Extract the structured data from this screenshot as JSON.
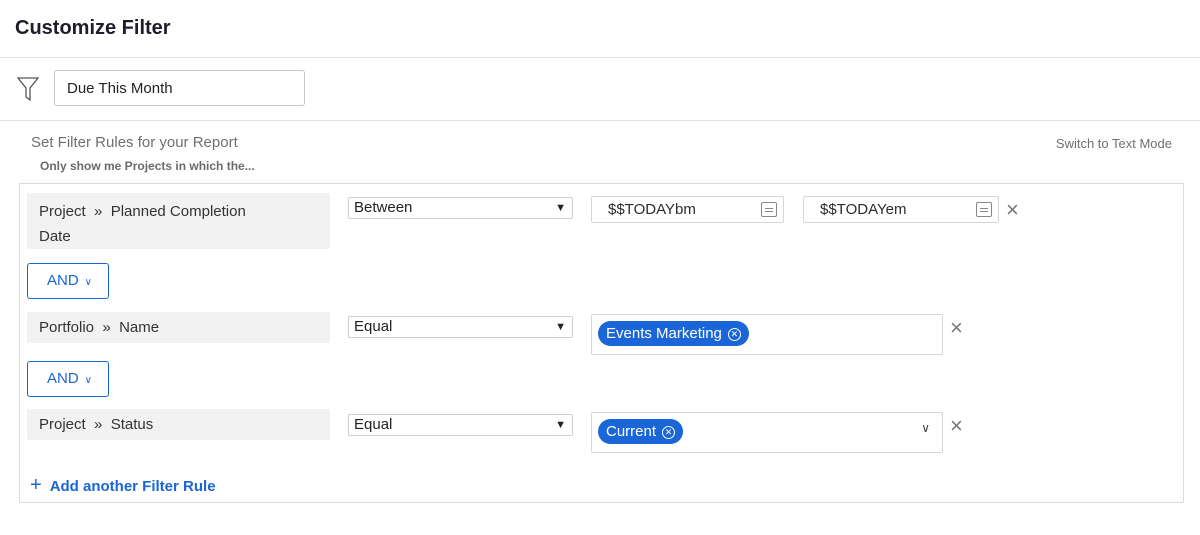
{
  "title": "Customize Filter",
  "filter_name": "Due This Month",
  "rules_heading": "Set Filter Rules for your Report",
  "rules_subheading": "Only show me Projects in which the...",
  "switch_mode": "Switch to Text Mode",
  "rules": [
    {
      "object": "Project",
      "separator": "»",
      "field_line1": "Planned Completion",
      "field_line2": "Date",
      "operator": "Between",
      "value1": "$$TODAYbm",
      "value2": "$$TODAYem"
    },
    {
      "object": "Portfolio",
      "separator": "»",
      "field": "Name",
      "operator": "Equal",
      "tag": "Events Marketing"
    },
    {
      "object": "Project",
      "separator": "»",
      "field": "Status",
      "operator": "Equal",
      "tag": "Current"
    }
  ],
  "connectors": [
    "AND",
    "AND"
  ],
  "add_rule": "Add another Filter Rule",
  "accent": "#1a66d6"
}
